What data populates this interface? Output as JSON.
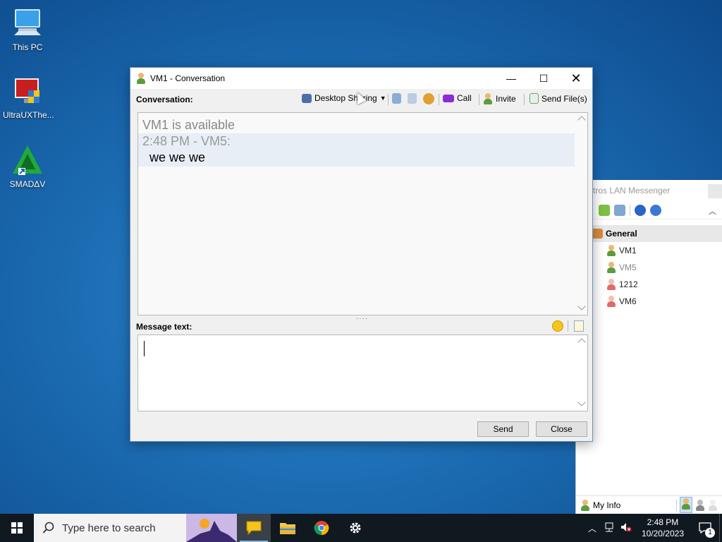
{
  "desktop": {
    "icons": [
      {
        "label": "This PC"
      },
      {
        "label": "UltraUXThe..."
      },
      {
        "label": "SMADΔV"
      }
    ]
  },
  "messenger": {
    "title": "tros LAN Messenger",
    "group": "General",
    "contacts": [
      {
        "name": "VM1",
        "status": "online"
      },
      {
        "name": "VM5",
        "status": "online"
      },
      {
        "name": "1212",
        "status": "offline"
      },
      {
        "name": "VM6",
        "status": "offline"
      }
    ],
    "my_info": "My Info"
  },
  "conversation": {
    "title": "VM1 - Conversation",
    "conversation_label": "Conversation:",
    "toolbar": {
      "desktop_sharing": "Desktop Sharing",
      "call": "Call",
      "invite": "Invite",
      "send_files": "Send File(s)"
    },
    "history": {
      "status_line": "VM1 is available",
      "sender_line": "2:48 PM - VM5:",
      "message": "we we we"
    },
    "message_label": "Message text:",
    "input_value": "",
    "send": "Send",
    "close": "Close"
  },
  "taskbar": {
    "search_placeholder": "Type here to search",
    "time": "2:48 PM",
    "date": "10/20/2023",
    "notification_count": "1"
  },
  "colors": {
    "accent": "#0078d7",
    "online": "#5d9c3a",
    "offline": "#e06a6a"
  }
}
